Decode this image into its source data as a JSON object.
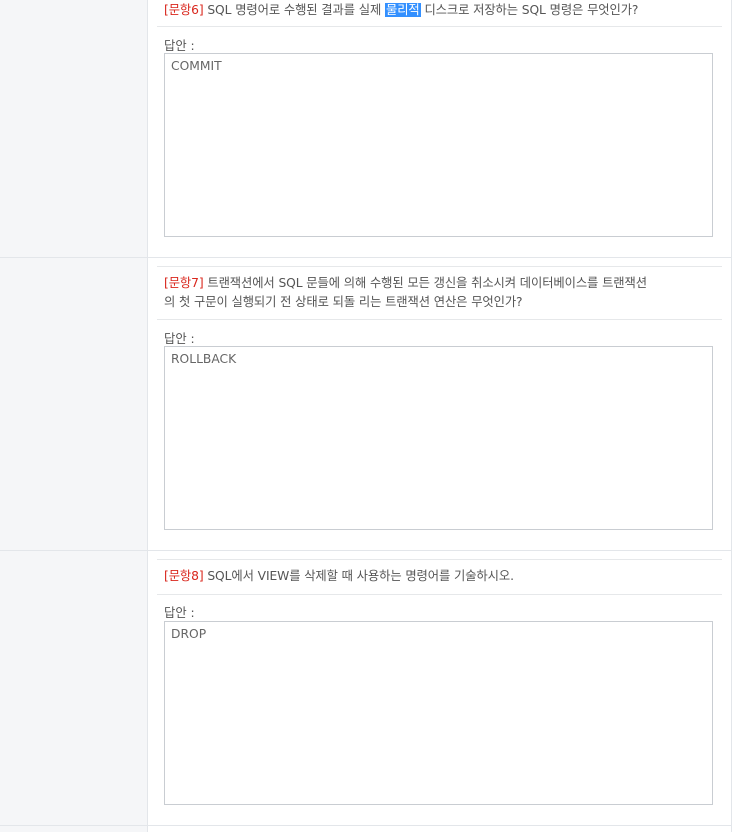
{
  "questions": [
    {
      "number_label": "[문항6]",
      "text_before": " SQL 명령어로 수행된 결과를 실제 ",
      "highlight": "물리적",
      "text_after": " 디스크로 저장하는 SQL 명령은 무엇인가?",
      "answer_label": "답안 :",
      "answer_value": "COMMIT"
    },
    {
      "number_label": "[문항7]",
      "text_line1": " 트랜잭션에서 SQL 문들에 의해 수행된 모든 갱신을 취소시켜 데이터베이스를 트랜잭션",
      "text_line2": "의 첫 구문이 실행되기 전 상태로 되돌 리는 트랜잭션 연산은 무엇인가?",
      "answer_label": "답안 :",
      "answer_value": "ROLLBACK"
    },
    {
      "number_label": "[문항8]",
      "text": " SQL에서 VIEW를 삭제할 때 사용하는 명령어를 기술하시오.",
      "answer_label": "답안 :",
      "answer_value": "DROP"
    }
  ]
}
